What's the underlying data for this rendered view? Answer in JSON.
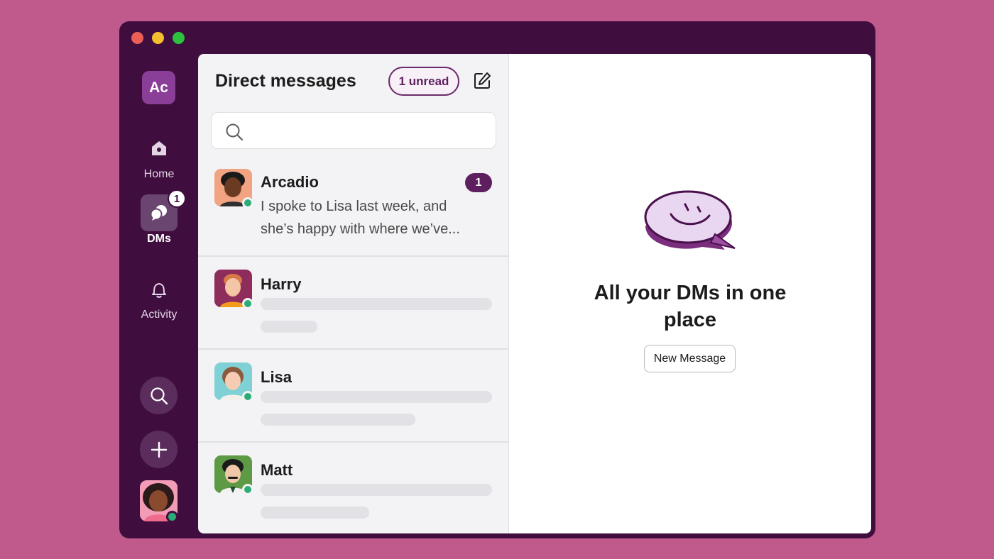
{
  "window": {
    "controls": [
      "close",
      "minimize",
      "zoom"
    ]
  },
  "sidebar": {
    "workspace_initials": "Ac",
    "items": [
      {
        "label": "Home",
        "icon": "home-icon"
      },
      {
        "label": "DMs",
        "icon": "dms-icon",
        "badge": "1",
        "active": true
      },
      {
        "label": "Activity",
        "icon": "bell-icon"
      }
    ],
    "actions": [
      {
        "icon": "search-icon"
      },
      {
        "icon": "plus-icon"
      }
    ],
    "user": {
      "status": "online"
    }
  },
  "dm_panel": {
    "title": "Direct messages",
    "unread_label": "1 unread",
    "search": {
      "value": "",
      "placeholder": ""
    },
    "conversations": [
      {
        "name": "Arcadio",
        "preview": "I spoke to Lisa last week, and she’s happy with where we’ve...",
        "unread": "1",
        "status": "online"
      },
      {
        "name": "Harry",
        "status": "online"
      },
      {
        "name": "Lisa",
        "status": "online"
      },
      {
        "name": "Matt",
        "status": "online"
      }
    ]
  },
  "main": {
    "title": "All your DMs in one place",
    "button_label": "New Message"
  },
  "colors": {
    "background": "#C05A8C",
    "aubergine": "#3F0E3F",
    "accent": "#5E1F5E",
    "online": "#2BAC76"
  }
}
